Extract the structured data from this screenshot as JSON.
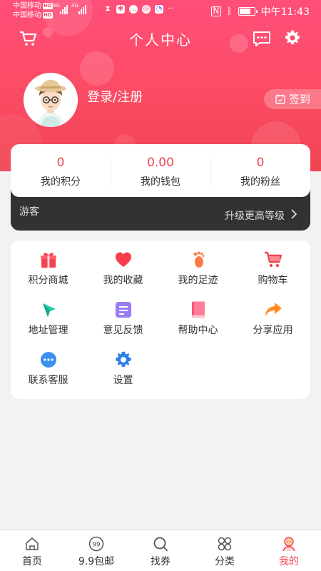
{
  "status_bar": {
    "carrier1": "中国移动",
    "carrier2": "中国移动",
    "hd": "HD",
    "net": "4G",
    "more": "···",
    "time": "中午11:43"
  },
  "header": {
    "title": "个人中心"
  },
  "profile": {
    "login_label": "登录/注册",
    "checkin_label": "签到"
  },
  "stats": [
    {
      "value": "0",
      "label": "我的积分"
    },
    {
      "value": "0.00",
      "label": "我的钱包"
    },
    {
      "value": "0",
      "label": "我的粉丝"
    }
  ],
  "member": {
    "level": "游客",
    "upgrade": "升级更高等级"
  },
  "grid": [
    {
      "label": "积分商城",
      "icon": "gift-icon"
    },
    {
      "label": "我的收藏",
      "icon": "heart-icon"
    },
    {
      "label": "我的足迹",
      "icon": "footprint-icon"
    },
    {
      "label": "购物车",
      "icon": "cart-icon"
    },
    {
      "label": "地址管理",
      "icon": "compass-icon"
    },
    {
      "label": "意见反馈",
      "icon": "feedback-icon"
    },
    {
      "label": "帮助中心",
      "icon": "book-icon"
    },
    {
      "label": "分享应用",
      "icon": "share-icon"
    },
    {
      "label": "联系客服",
      "icon": "chat-icon"
    },
    {
      "label": "设置",
      "icon": "gear-icon"
    }
  ],
  "tabbar": [
    {
      "label": "首页",
      "icon": "home-icon"
    },
    {
      "label": "9.9包邮",
      "icon": "nine-nine-icon"
    },
    {
      "label": "找券",
      "icon": "search-icon"
    },
    {
      "label": "分类",
      "icon": "category-icon"
    },
    {
      "label": "我的",
      "icon": "user-icon",
      "active": true
    }
  ],
  "colors": {
    "brand": "#f04452",
    "header_top": "#ff4f79",
    "vip_bar": "#323232"
  }
}
